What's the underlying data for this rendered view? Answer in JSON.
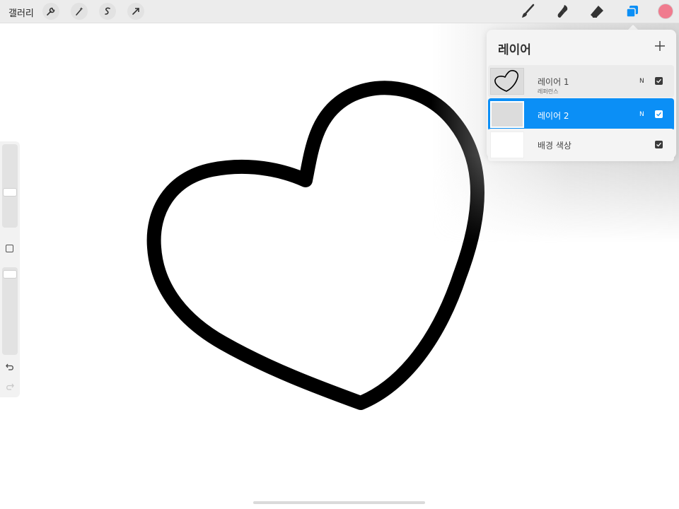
{
  "topbar": {
    "gallery_label": "갤러리",
    "left_tools": [
      "wrench-icon",
      "magic-wand-icon",
      "selection-icon",
      "transform-arrow-icon"
    ],
    "right_tools": [
      "brush-icon",
      "smudge-icon",
      "eraser-icon",
      "layers-icon"
    ],
    "active_tool": "layers-icon",
    "accent_color": "#0b8ff6",
    "current_color": "#f07b8e"
  },
  "layers_panel": {
    "title": "레이어",
    "add_icon": "plus-icon",
    "layers": [
      {
        "name": "레이어 1",
        "subtitle": "레퍼런스",
        "blend": "N",
        "visible": true,
        "selected": false
      },
      {
        "name": "레이어 2",
        "subtitle": "",
        "blend": "N",
        "visible": true,
        "selected": true
      },
      {
        "name": "배경 색상",
        "subtitle": "",
        "blend": "",
        "visible": true,
        "selected": false
      }
    ]
  },
  "sidebar": {
    "brush_size_level": 0.43,
    "opacity_level": 0.98,
    "controls": [
      "modify-button",
      "undo-icon",
      "redo-icon"
    ]
  },
  "canvas": {
    "drawing": "heart-outline",
    "stroke_color": "#000000"
  }
}
